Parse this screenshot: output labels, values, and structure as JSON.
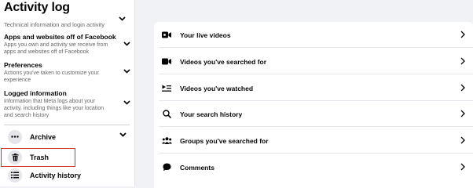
{
  "sidebar": {
    "title": "Activity log",
    "cut_text": "Technical information and login activity",
    "categories": [
      {
        "title": "Apps and websites off of Facebook",
        "desc": "Apps you own and activity we receive from apps and websites off of Facebook"
      },
      {
        "title": "Preferences",
        "desc": "Actions you've taken to customize your experience"
      },
      {
        "title": "Logged information",
        "desc": "Information that Meta logs about your activity, including things like your location and search history"
      }
    ],
    "rows": [
      {
        "label": "Archive",
        "icon": "more-dots-icon"
      },
      {
        "label": "Trash",
        "icon": "trash-icon"
      },
      {
        "label": "Activity history",
        "icon": "list-icon"
      }
    ]
  },
  "main": {
    "items": [
      {
        "label": "Your live videos",
        "icon": "video-camera-icon"
      },
      {
        "label": "Videos you've searched for",
        "icon": "video-camera-icon"
      },
      {
        "label": "Videos you've watched",
        "icon": "watched-video-icon"
      },
      {
        "label": "Your search history",
        "icon": "search-icon"
      },
      {
        "label": "Groups you've searched for",
        "icon": "groups-icon"
      },
      {
        "label": "Comments",
        "icon": "comment-icon"
      }
    ]
  },
  "colors": {
    "highlight": "#d0342c",
    "background": "#f0f2f5",
    "panel": "#ffffff",
    "secondary_text": "#65676b"
  }
}
